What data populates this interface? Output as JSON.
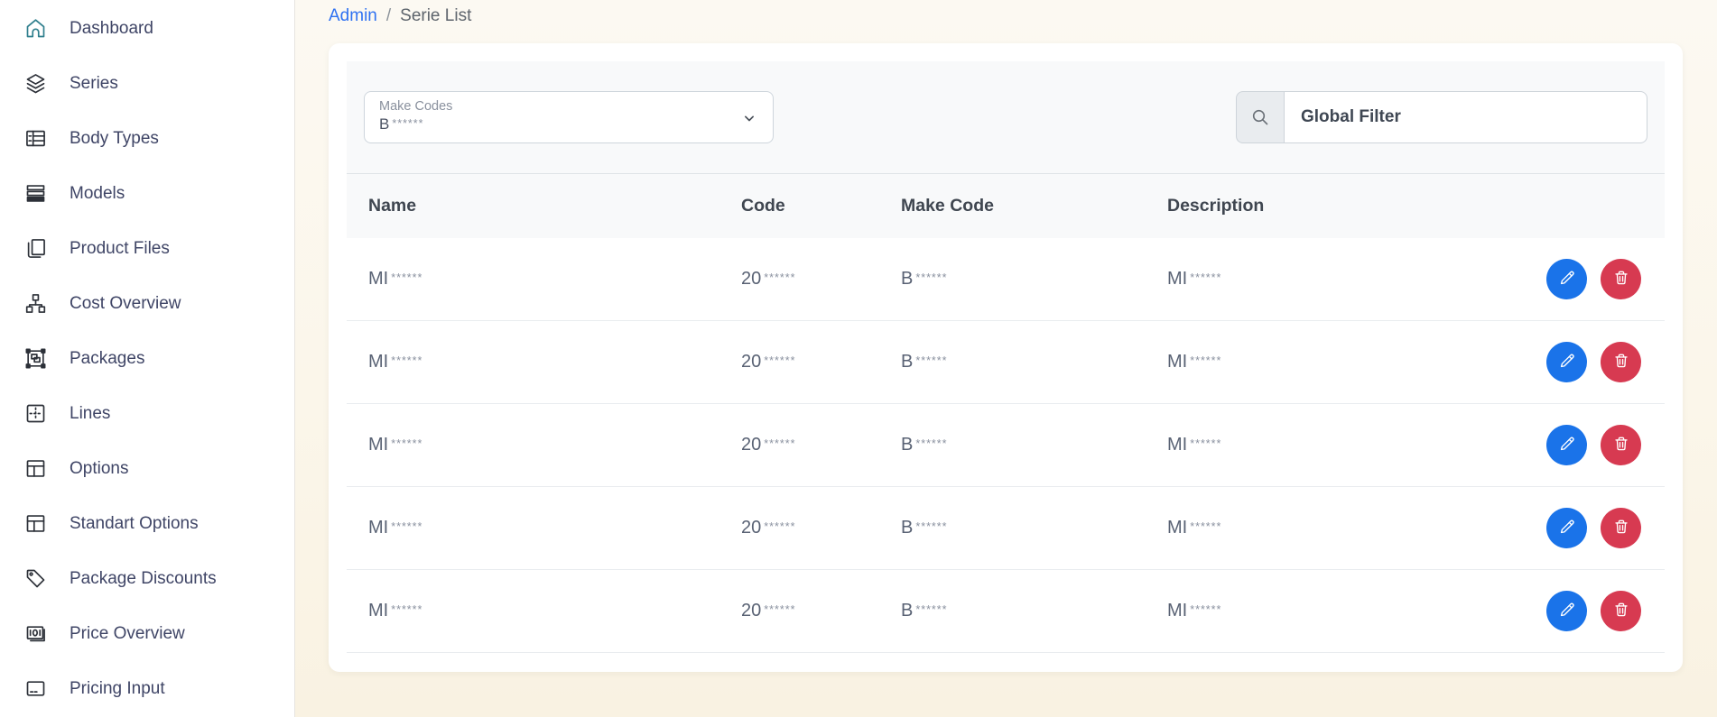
{
  "sidebar": {
    "items": [
      {
        "label": "Dashboard",
        "icon": "home-icon",
        "active": true
      },
      {
        "label": "Series",
        "icon": "layers-icon",
        "active": false
      },
      {
        "label": "Body Types",
        "icon": "spreadsheet-icon",
        "active": false
      },
      {
        "label": "Models",
        "icon": "rows-icon",
        "active": false
      },
      {
        "label": "Product Files",
        "icon": "copy-icon",
        "active": false
      },
      {
        "label": "Cost Overview",
        "icon": "sitemap-icon",
        "active": false
      },
      {
        "label": "Packages",
        "icon": "object-group-icon",
        "active": false
      },
      {
        "label": "Lines",
        "icon": "border-cross-icon",
        "active": false
      },
      {
        "label": "Options",
        "icon": "table-icon",
        "active": false
      },
      {
        "label": "Standart Options",
        "icon": "table-icon",
        "active": false
      },
      {
        "label": "Package Discounts",
        "icon": "tag-icon",
        "active": false
      },
      {
        "label": "Price Overview",
        "icon": "banknote-icon",
        "active": false
      },
      {
        "label": "Pricing Input",
        "icon": "card-icon",
        "active": false
      }
    ]
  },
  "breadcrumb": {
    "parent": "Admin",
    "separator": "/",
    "current": "Serie List"
  },
  "filters": {
    "make_codes": {
      "label": "Make Codes",
      "value_prefix": "B",
      "value_mask": "******"
    },
    "global_filter": {
      "placeholder": "Global Filter"
    }
  },
  "table": {
    "columns": [
      "Name",
      "Code",
      "Make Code",
      "Description"
    ],
    "rows": [
      {
        "name": {
          "prefix": "MI",
          "mask": "******"
        },
        "code": {
          "prefix": "20",
          "mask": "******"
        },
        "make_code": {
          "prefix": "B",
          "mask": "******"
        },
        "description": {
          "prefix": "MI",
          "mask": "******"
        }
      },
      {
        "name": {
          "prefix": "MI",
          "mask": "******"
        },
        "code": {
          "prefix": "20",
          "mask": "******"
        },
        "make_code": {
          "prefix": "B",
          "mask": "******"
        },
        "description": {
          "prefix": "MI",
          "mask": "******"
        }
      },
      {
        "name": {
          "prefix": "MI",
          "mask": "******"
        },
        "code": {
          "prefix": "20",
          "mask": "******"
        },
        "make_code": {
          "prefix": "B",
          "mask": "******"
        },
        "description": {
          "prefix": "MI",
          "mask": "******"
        }
      },
      {
        "name": {
          "prefix": "MI",
          "mask": "******"
        },
        "code": {
          "prefix": "20",
          "mask": "******"
        },
        "make_code": {
          "prefix": "B",
          "mask": "******"
        },
        "description": {
          "prefix": "MI",
          "mask": "******"
        }
      },
      {
        "name": {
          "prefix": "MI",
          "mask": "******"
        },
        "code": {
          "prefix": "20",
          "mask": "******"
        },
        "make_code": {
          "prefix": "B",
          "mask": "******"
        },
        "description": {
          "prefix": "MI",
          "mask": "******"
        }
      }
    ]
  },
  "colors": {
    "accent_link": "#2f72f2",
    "edit_button": "#1a73e9",
    "delete_button": "#d73a51",
    "dashboard_icon": "#2f7f8d"
  }
}
